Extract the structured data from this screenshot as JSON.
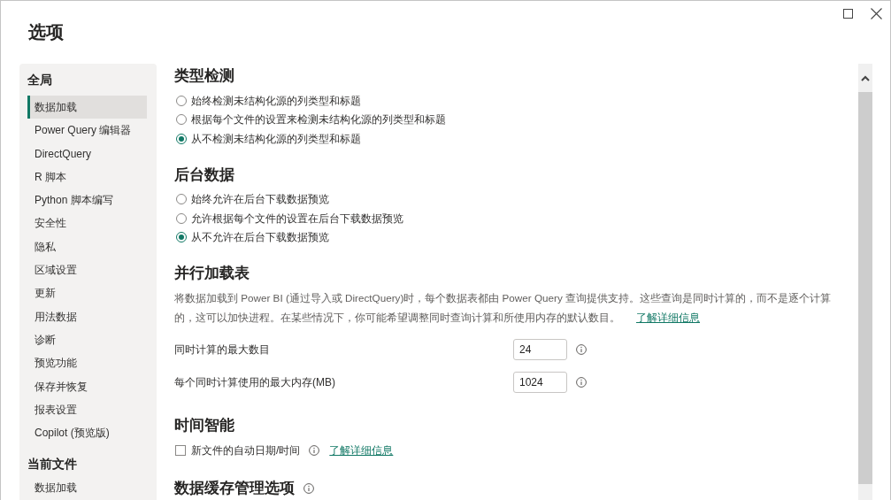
{
  "window": {
    "title": "选项"
  },
  "sidebar": {
    "sections": [
      {
        "heading": "全局",
        "items": [
          {
            "label": "数据加载",
            "selected": true
          },
          {
            "label": "Power Query 编辑器",
            "selected": false
          },
          {
            "label": "DirectQuery",
            "selected": false
          },
          {
            "label": "R 脚本",
            "selected": false
          },
          {
            "label": "Python 脚本编写",
            "selected": false
          },
          {
            "label": "安全性",
            "selected": false
          },
          {
            "label": "隐私",
            "selected": false
          },
          {
            "label": "区域设置",
            "selected": false
          },
          {
            "label": "更新",
            "selected": false
          },
          {
            "label": "用法数据",
            "selected": false
          },
          {
            "label": "诊断",
            "selected": false
          },
          {
            "label": "预览功能",
            "selected": false
          },
          {
            "label": "保存并恢复",
            "selected": false
          },
          {
            "label": "报表设置",
            "selected": false
          },
          {
            "label": "Copilot (预览版)",
            "selected": false
          }
        ]
      },
      {
        "heading": "当前文件",
        "items": [
          {
            "label": "数据加载",
            "selected": false
          }
        ]
      }
    ]
  },
  "content": {
    "sections": [
      {
        "kind": "radios",
        "heading": "类型检测",
        "options": [
          {
            "label": "始终检测未结构化源的列类型和标题",
            "selected": false
          },
          {
            "label": "根据每个文件的设置来检测未结构化源的列类型和标题",
            "selected": false
          },
          {
            "label": "从不检测未结构化源的列类型和标题",
            "selected": true
          }
        ]
      },
      {
        "kind": "radios",
        "heading": "后台数据",
        "options": [
          {
            "label": "始终允许在后台下载数据预览",
            "selected": false
          },
          {
            "label": "允许根据每个文件的设置在后台下载数据预览",
            "selected": false
          },
          {
            "label": "从不允许在后台下载数据预览",
            "selected": true
          }
        ]
      },
      {
        "kind": "fields",
        "heading": "并行加载表",
        "description": "将数据加载到 Power BI (通过导入或 DirectQuery)时，每个数据表都由 Power Query 查询提供支持。这些查询是同时计算的，而不是逐个计算的，这可以加快进程。在某些情况下，你可能希望调整同时查询计算和所使用内存的默认数目。",
        "link": "了解详细信息",
        "fields": [
          {
            "label": "同时计算的最大数目",
            "value": "24",
            "info": true
          },
          {
            "label": "每个同时计算使用的最大内存(MB)",
            "value": "1024",
            "info": true
          }
        ]
      },
      {
        "kind": "checkboxes",
        "heading": "时间智能",
        "options": [
          {
            "label": "新文件的自动日期/时间",
            "checked": false,
            "info": true,
            "link": "了解详细信息"
          }
        ]
      },
      {
        "kind": "heading",
        "heading": "数据缓存管理选项",
        "info": true
      }
    ]
  }
}
